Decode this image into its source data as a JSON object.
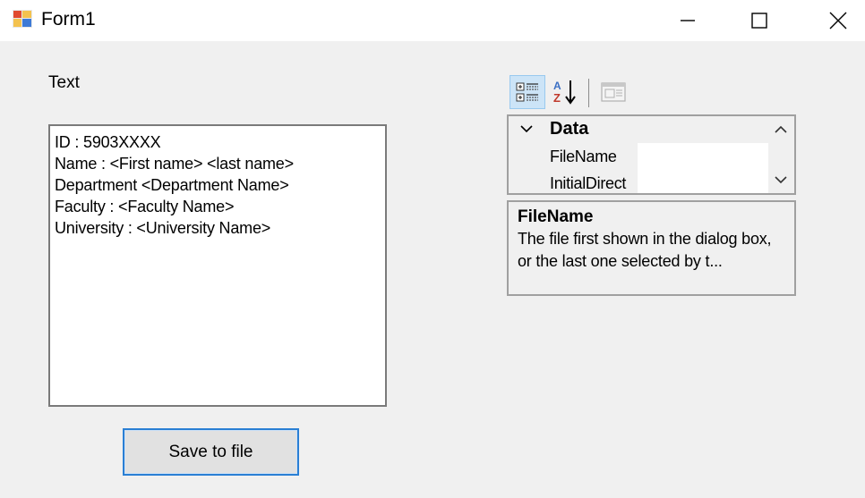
{
  "window": {
    "title": "Form1",
    "controls": [
      "minimize",
      "maximize",
      "close"
    ]
  },
  "label_text": "Text",
  "textbox": {
    "lines": [
      "ID : 5903XXXX",
      "Name : <First name> <last name>",
      "Department <Department Name>",
      "Faculty : <Faculty Name>",
      "University : <University Name>"
    ]
  },
  "save_button": "Save to file",
  "property_grid": {
    "toolbar": [
      "categorized-icon",
      "alphabetical-icon",
      "property-pages-icon"
    ],
    "category": "Data",
    "properties": [
      {
        "name": "FileName",
        "value": ""
      },
      {
        "name": "InitialDirect",
        "value": ""
      }
    ],
    "description": {
      "title": "FileName",
      "text": "The file first shown in the dialog box, or the last one selected by t..."
    }
  },
  "colors": {
    "form_bg": "#f0f0f0",
    "accent": "#2a7fd4",
    "toolbar_selected": "#cce4f7"
  }
}
